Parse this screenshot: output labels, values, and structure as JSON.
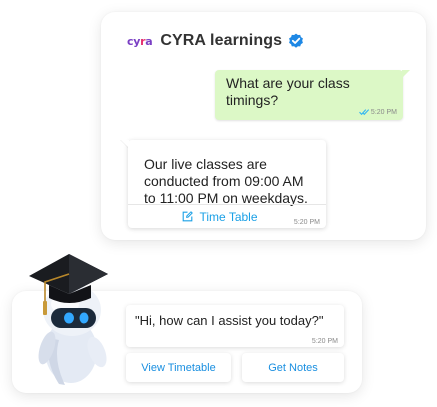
{
  "chat": {
    "brand_logo": "cyra",
    "brand_name": "CYRA learnings",
    "outgoing": {
      "text": "What are your class timings?",
      "time": "5:20 PM"
    },
    "incoming": {
      "text": "Our live classes are conducted from 09:00 AM to 11:00 PM on weekdays.",
      "action_label": "Time Table",
      "time": "5:20 PM"
    }
  },
  "widget": {
    "greeting": "\"Hi, how can I assist you today?\"",
    "time": "5:20 PM",
    "buttons": [
      "View Timetable",
      "Get Notes"
    ]
  },
  "colors": {
    "accent_blue": "#1aa0e6",
    "outgoing_bubble": "#dcf8c6",
    "brand_purple": "#7a3fc4",
    "brand_pink": "#e5306f"
  },
  "icons": {
    "verified": "verified-badge-icon",
    "read_receipt": "double-check-icon",
    "time_table": "edit-icon",
    "mascot": "robot-graduate-mascot"
  }
}
